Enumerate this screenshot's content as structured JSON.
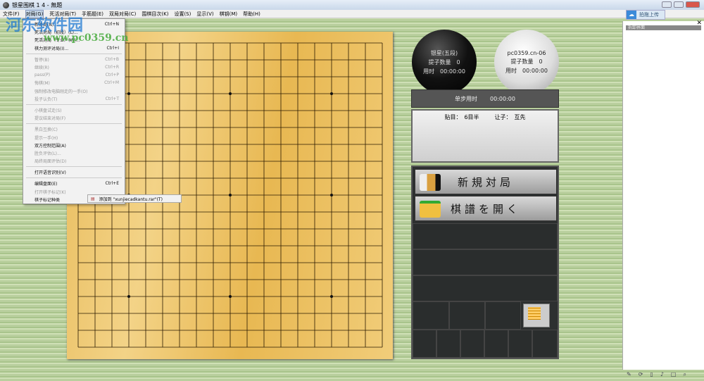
{
  "window": {
    "title": "银星围棋 1 4 - 無題"
  },
  "menubar": [
    "文件(F)",
    "对局(G)",
    "死活对局(T)",
    "手筋题(E)",
    "双局对局(C)",
    "围棋目次(K)",
    "设置(S)",
    "显示(V)",
    "棋钥(M)",
    "帮助(H)"
  ],
  "upload_label": "拍拖上传",
  "side_panel": {
    "header": "拆卸界面"
  },
  "menu": {
    "items": [
      {
        "label": "新对局(N)...",
        "shortcut": "Ctrl+N",
        "enabled": true
      },
      {
        "label": "死活对局（初段）(L)...",
        "shortcut": "",
        "enabled": true
      },
      {
        "label": "死活对局（专业）(W)...",
        "shortcut": "",
        "enabled": true
      },
      {
        "label": "棋力测评对局(I)...",
        "shortcut": "Ctrl+I",
        "enabled": true
      },
      {
        "sep": true
      },
      {
        "label": "暂停(B)",
        "shortcut": "Ctrl+B",
        "enabled": false
      },
      {
        "label": "继续(R)",
        "shortcut": "Ctrl+R",
        "enabled": false
      },
      {
        "label": "pass(P)",
        "shortcut": "Ctrl+P",
        "enabled": false
      },
      {
        "label": "悔棋(M)",
        "shortcut": "Ctrl+M",
        "enabled": false
      },
      {
        "label": "强制修改电脑刚走的一手(O)",
        "shortcut": "",
        "enabled": false
      },
      {
        "label": "投子认负(T)",
        "shortcut": "Ctrl+T",
        "enabled": false
      },
      {
        "sep": true
      },
      {
        "label": "小棋盘试走(S)",
        "shortcut": "",
        "enabled": false
      },
      {
        "label": "提议结束对局(F)",
        "shortcut": "",
        "enabled": false
      },
      {
        "sep": true
      },
      {
        "label": "黑白互换(C)",
        "shortcut": "",
        "enabled": false
      },
      {
        "label": "提示一手(H)",
        "shortcut": "",
        "enabled": false
      },
      {
        "label": "双方控制范围(A)",
        "shortcut": "",
        "enabled": true
      },
      {
        "label": "胜负评估(L)...",
        "shortcut": "",
        "enabled": false
      },
      {
        "label": "局终局面评估(D)",
        "shortcut": "",
        "enabled": false
      },
      {
        "sep": true
      },
      {
        "label": "打开语音识别(V)",
        "shortcut": "",
        "enabled": true
      },
      {
        "sep": true
      },
      {
        "label": "编辑盘面(E)",
        "shortcut": "Ctrl+E",
        "enabled": true
      },
      {
        "label": "打开棋子标记(K)",
        "shortcut": "",
        "enabled": false
      },
      {
        "label": "棋子标记种类",
        "shortcut": "",
        "enabled": true
      }
    ]
  },
  "submenu": {
    "label": "添加到 \"xunjiecadkantu.rar\"(T)"
  },
  "watermark": {
    "text": "河东软件园",
    "url": "www.pc0359.cn"
  },
  "black_player": {
    "name": "银星(五段)",
    "captures": "提子数量　0",
    "time": "用时　00:00:00"
  },
  "white_player": {
    "name": "pc0359.cn-06",
    "captures": "提子数量　0",
    "time": "用时　00:00:00"
  },
  "step_time": {
    "label": "单步用时",
    "value": "00:00:00"
  },
  "game_info": {
    "komi": "贴目：　6目半",
    "handicap": "让子：　互先"
  },
  "buttons": {
    "new_game": "新規対局",
    "open_record": "棋譜を開く"
  },
  "status_icons": [
    "pin-icon",
    "refresh-icon",
    "clipboard-icon",
    "speaker-icon",
    "window-icon",
    "search-icon"
  ]
}
